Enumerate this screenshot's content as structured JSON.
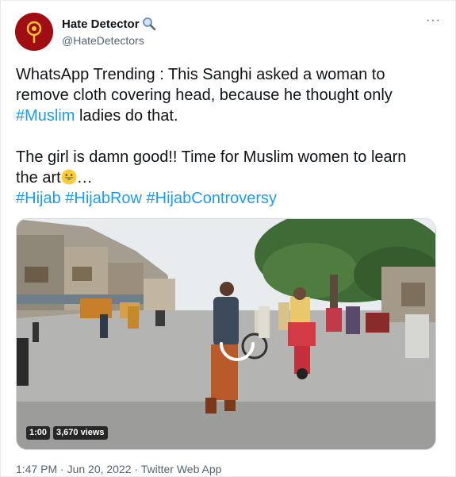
{
  "user": {
    "display_name": "Hate Detector",
    "handle": "@HateDetectors",
    "name_emoji": "magnifying-glass-icon",
    "brand_color": "#a00d12"
  },
  "tweet": {
    "line1": "WhatsApp Trending : This Sanghi asked a woman to",
    "line2": "remove cloth covering head, because he thought only",
    "hashtag_muslim": "#Muslim",
    "line3_rest": " ladies do that.",
    "line4": "The girl is damn good!! Time for Muslim women to learn",
    "line5_start": "the art",
    "line5_emoji": "grinning-face-icon",
    "line5_end": "…",
    "hashtags": [
      "#Hijab",
      "#HijabRow",
      "#HijabControversy"
    ]
  },
  "media": {
    "duration": "1:00",
    "views": "3,670 views"
  },
  "meta": {
    "timestamp": "1:47 PM · Jun 20, 2022 · Twitter Web App"
  },
  "colors": {
    "link": "#1d9bf0",
    "secondary_text": "#536471"
  }
}
